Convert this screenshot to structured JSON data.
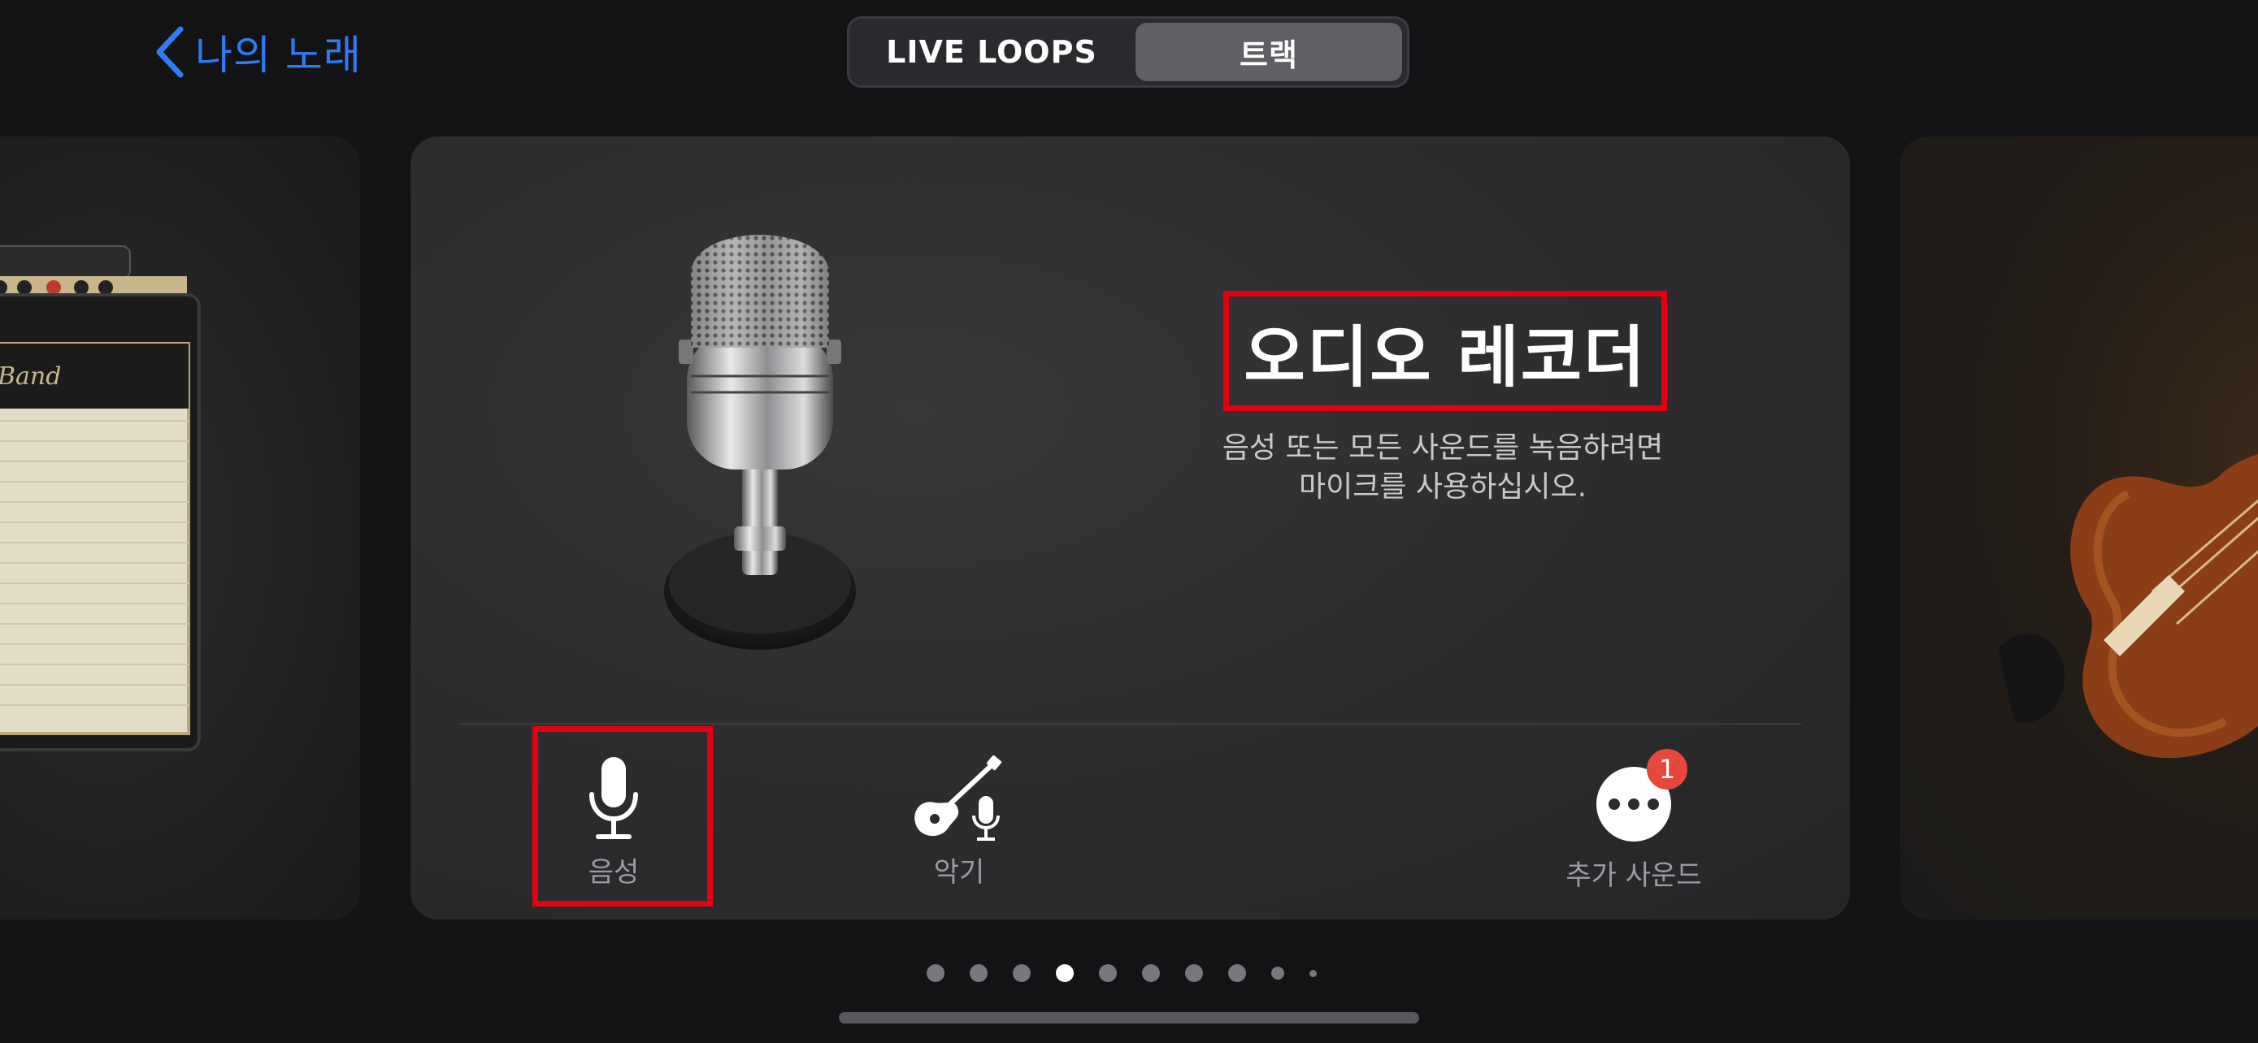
{
  "nav": {
    "back_label": "나의 노래"
  },
  "segmented_control": {
    "live_loops_label": "LIVE LOOPS",
    "tracks_label": "트랙",
    "selected": "트랙"
  },
  "main_card": {
    "title": "오디오 레코더",
    "subtitle_line1": "음성 또는 모든 사운드를 녹음하려면",
    "subtitle_line2": "마이크를 사용하십시오."
  },
  "side_cards": {
    "amp_brand_text": "GarageBand"
  },
  "tools": [
    {
      "label": "음성",
      "icon": "microphone-icon"
    },
    {
      "label": "악기",
      "icon": "guitar-mic-icon"
    },
    {
      "label": "추가 사운드",
      "icon": "more-icon",
      "badge": "1"
    }
  ],
  "pagination": {
    "total": 10,
    "active_index": 3
  },
  "colors": {
    "accent": "#2f7bf5",
    "highlight_box": "#e4000f",
    "badge": "#e8473c",
    "background": "#131315"
  }
}
